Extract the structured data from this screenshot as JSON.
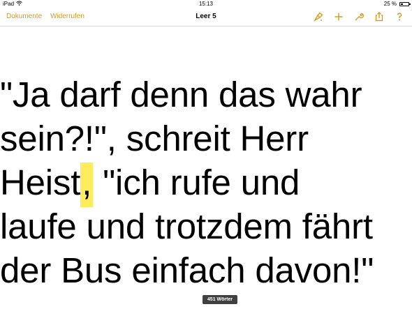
{
  "status_bar": {
    "device": "iPad",
    "time": "15:13",
    "battery_text": "25 %"
  },
  "toolbar": {
    "documents_label": "Dokumente",
    "undo_label": "Widerrufen",
    "title": "Leer 5"
  },
  "document": {
    "lines": [
      "\"Ja darf denn das wahr",
      "sein?!\", schreit Herr",
      "Heist",
      ",",
      " \"ich rufe und",
      "laufe und trotzdem fährt",
      "der Bus einfach davon!\""
    ]
  },
  "word_count": "451 Wörter",
  "colors": {
    "accent": "#d79b1d",
    "highlight": "#ffec5c"
  }
}
